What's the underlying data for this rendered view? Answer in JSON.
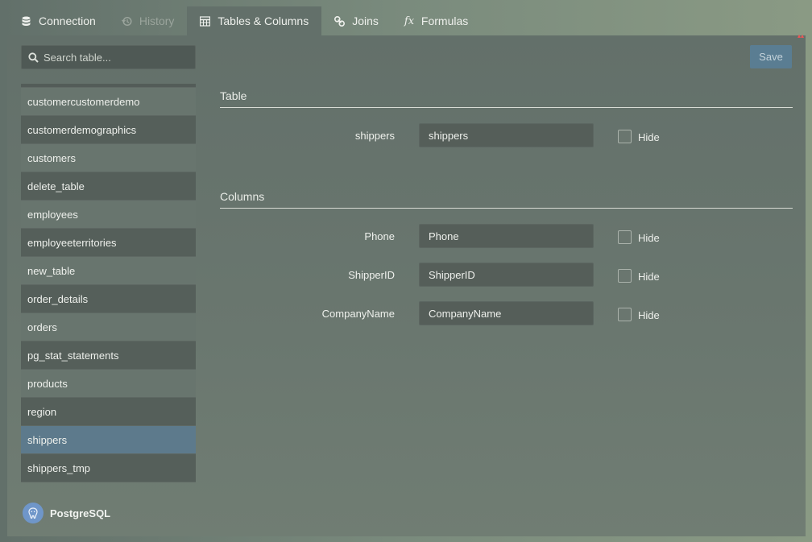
{
  "tabs": [
    {
      "label": "Connection",
      "icon": "database-icon",
      "state": "normal"
    },
    {
      "label": "History",
      "icon": "history-icon",
      "state": "disabled"
    },
    {
      "label": "Tables & Columns",
      "icon": "table-icon",
      "state": "active"
    },
    {
      "label": "Joins",
      "icon": "link-icon",
      "state": "normal"
    },
    {
      "label": "Formulas",
      "icon": "fx-icon",
      "state": "normal",
      "glyph": "fx"
    }
  ],
  "sidebar": {
    "search_placeholder": "Search table...",
    "items": [
      "customercustomerdemo",
      "customerdemographics",
      "customers",
      "delete_table",
      "employees",
      "employeeterritories",
      "new_table",
      "order_details",
      "orders",
      "pg_stat_statements",
      "products",
      "region",
      "shippers",
      "shippers_tmp"
    ],
    "selected": "shippers",
    "database": "PostgreSQL"
  },
  "toolbar": {
    "save_label": "Save"
  },
  "table_section": {
    "title": "Table",
    "row": {
      "label": "shippers",
      "value": "shippers",
      "hide_label": "Hide",
      "hidden": false
    }
  },
  "columns_section": {
    "title": "Columns",
    "rows": [
      {
        "label": "Phone",
        "value": "Phone",
        "hide_label": "Hide",
        "hidden": false
      },
      {
        "label": "ShipperID",
        "value": "ShipperID",
        "hide_label": "Hide",
        "hidden": false
      },
      {
        "label": "CompanyName",
        "value": "CompanyName",
        "hide_label": "Hide",
        "hidden": false
      }
    ]
  },
  "colors": {
    "accent": "#5a7d92",
    "selected_row": "#5d7a8c",
    "panel": "#63706a"
  }
}
